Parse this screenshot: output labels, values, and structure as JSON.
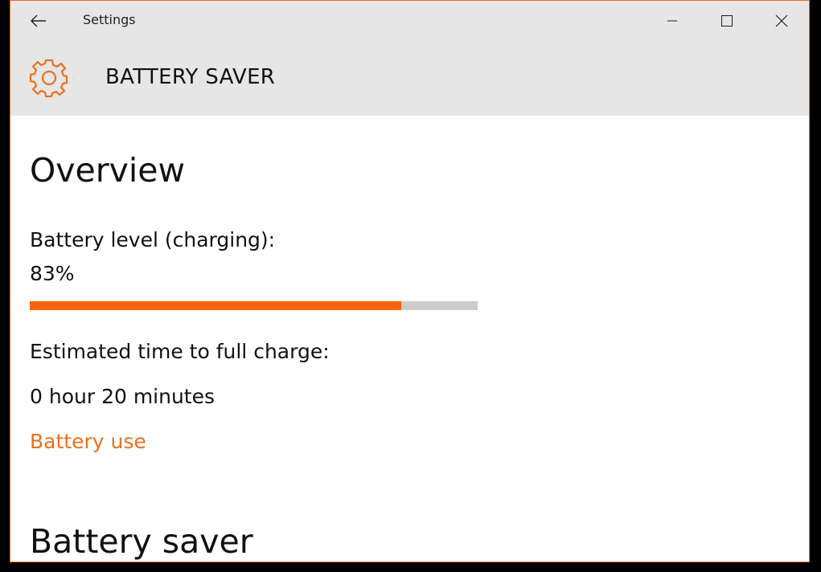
{
  "titlebar": {
    "title": "Settings",
    "back_icon": "arrow-left-icon",
    "minimize_icon": "minimize-icon",
    "maximize_icon": "maximize-icon",
    "close_icon": "close-icon"
  },
  "header": {
    "icon": "gear-icon",
    "title": "BATTERY SAVER"
  },
  "overview": {
    "heading": "Overview",
    "battery_level_label": "Battery level (charging):",
    "battery_level_value": "83%",
    "battery_level_fraction": 0.83,
    "estimated_label": "Estimated time to full charge:",
    "estimated_value": "0 hour 20 minutes",
    "battery_use_link": "Battery use"
  },
  "battery_saver": {
    "heading": "Battery saver"
  },
  "colors": {
    "accent": "#f7630c",
    "link": "#e8701e",
    "header_bg": "#e6e6e6",
    "progress_track": "#cccccc",
    "window_border": "#e8701e"
  }
}
